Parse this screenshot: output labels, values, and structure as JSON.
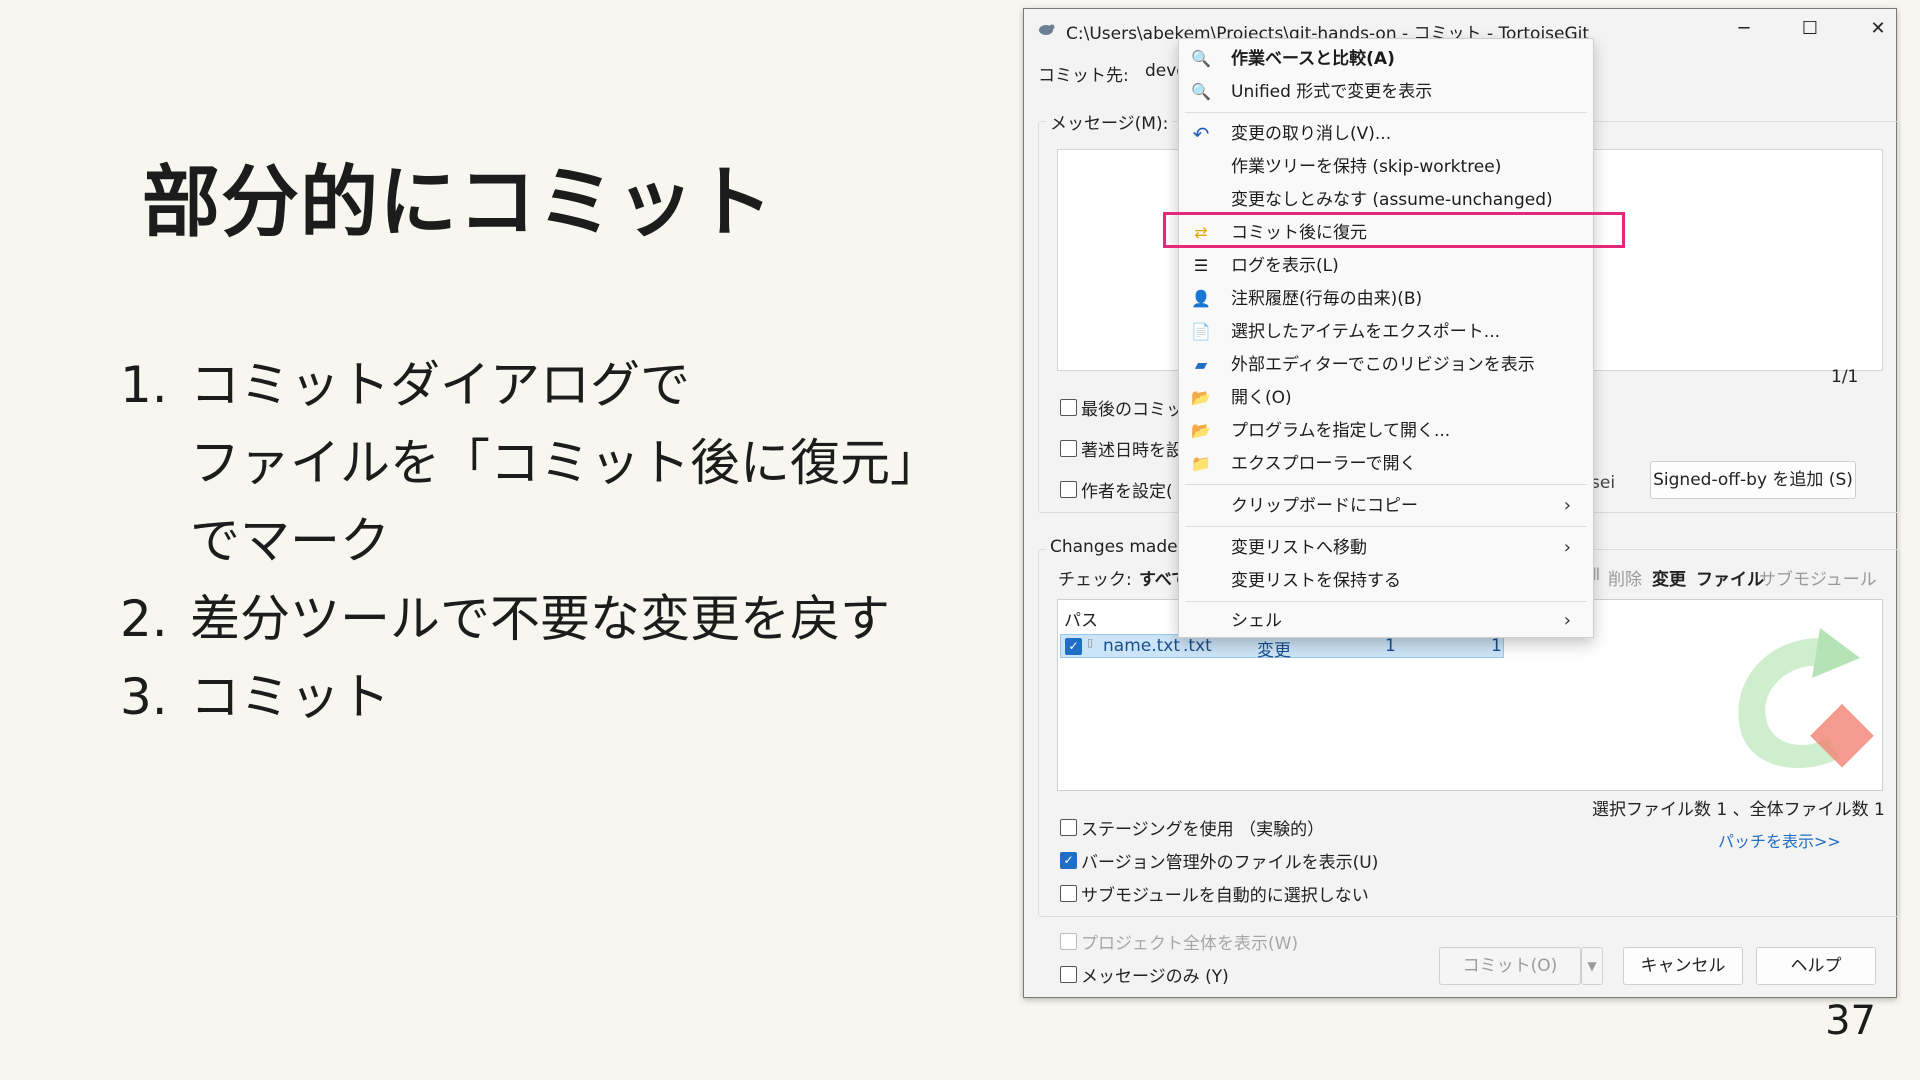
{
  "slide": {
    "title": "部分的にコミット",
    "steps": [
      {
        "num": "1.",
        "lines": [
          "コミットダイアログで",
          "ファイルを「コミット後に復元」",
          "でマーク"
        ]
      },
      {
        "num": "2.",
        "lines": [
          "差分ツールで不要な変更を戻す"
        ]
      },
      {
        "num": "3.",
        "lines": [
          "コミット"
        ]
      }
    ],
    "page_number": "37"
  },
  "dialog": {
    "title": "C:\\Users\\abekem\\Projects\\git-hands-on - コミット - TortoiseGit",
    "commit_to_label": "コミット先:",
    "commit_to_value": "deve",
    "message_label": "メッセージ(M):",
    "counter": "1/1",
    "options": {
      "last_commit": "最後のコミット",
      "set_date": "著述日時を設",
      "set_author": "作者を設定(",
      "partial_se": "sei",
      "signed_off": "Signed-off-by を追加 (S)"
    },
    "changes_label": "Changes made (",
    "check_label": "チェック:",
    "check_all": "すべて",
    "filters": [
      "削除",
      "変更",
      "ファイル",
      "サブモジュール"
    ],
    "filter_prefix": "Ⅱ",
    "columns": {
      "path": "パス"
    },
    "file_row": {
      "name": "name.txt",
      "ext": ".txt",
      "status": "変更",
      "added": "1",
      "removed": "1"
    },
    "summary": "選択ファイル数 1 、全体ファイル数 1",
    "show_patch": "パッチを表示>>",
    "staging": "ステージングを使用 （実験的）",
    "show_unversioned": "バージョン管理外のファイルを表示(U)",
    "no_submodules": "サブモジュールを自動的に選択しない",
    "show_whole_project": "プロジェクト全体を表示(W)",
    "message_only": "メッセージのみ (Y)",
    "commit_button": "コミット(O)",
    "cancel_button": "キャンセル",
    "help_button": "ヘルプ",
    "accent_color": "#1f6fc5"
  },
  "context_menu": {
    "items": [
      {
        "label": "作業ベースと比較(A)",
        "icon": "magnifier-icon",
        "bold": true
      },
      {
        "label": "Unified 形式で変更を表示",
        "icon": "magnifier-icon"
      },
      {
        "label": "変更の取り消し(V)...",
        "icon": "undo-icon"
      },
      {
        "label": "作業ツリーを保持 (skip-worktree)",
        "icon": ""
      },
      {
        "label": "変更なしとみなす (assume-unchanged)",
        "icon": ""
      },
      {
        "label": "コミット後に復元",
        "icon": "restore-icon",
        "highlighted": true
      },
      {
        "label": "ログを表示(L)",
        "icon": "log-icon"
      },
      {
        "label": "注釈履歴(行毎の由来)(B)",
        "icon": "blame-icon"
      },
      {
        "label": "選択したアイテムをエクスポート...",
        "icon": "export-icon"
      },
      {
        "label": "外部エディターでこのリビジョンを表示",
        "icon": "editor-icon"
      },
      {
        "label": "開く(O)",
        "icon": "folder-icon"
      },
      {
        "label": "プログラムを指定して開く...",
        "icon": "folder-icon"
      },
      {
        "label": "エクスプローラーで開く",
        "icon": "explorer-icon"
      },
      {
        "label": "クリップボードにコピー",
        "submenu": true
      },
      {
        "label": "変更リストへ移動",
        "submenu": true
      },
      {
        "label": "変更リストを保持する"
      },
      {
        "label": "シェル",
        "submenu": true
      }
    ],
    "highlight_color": "#e5287a"
  }
}
